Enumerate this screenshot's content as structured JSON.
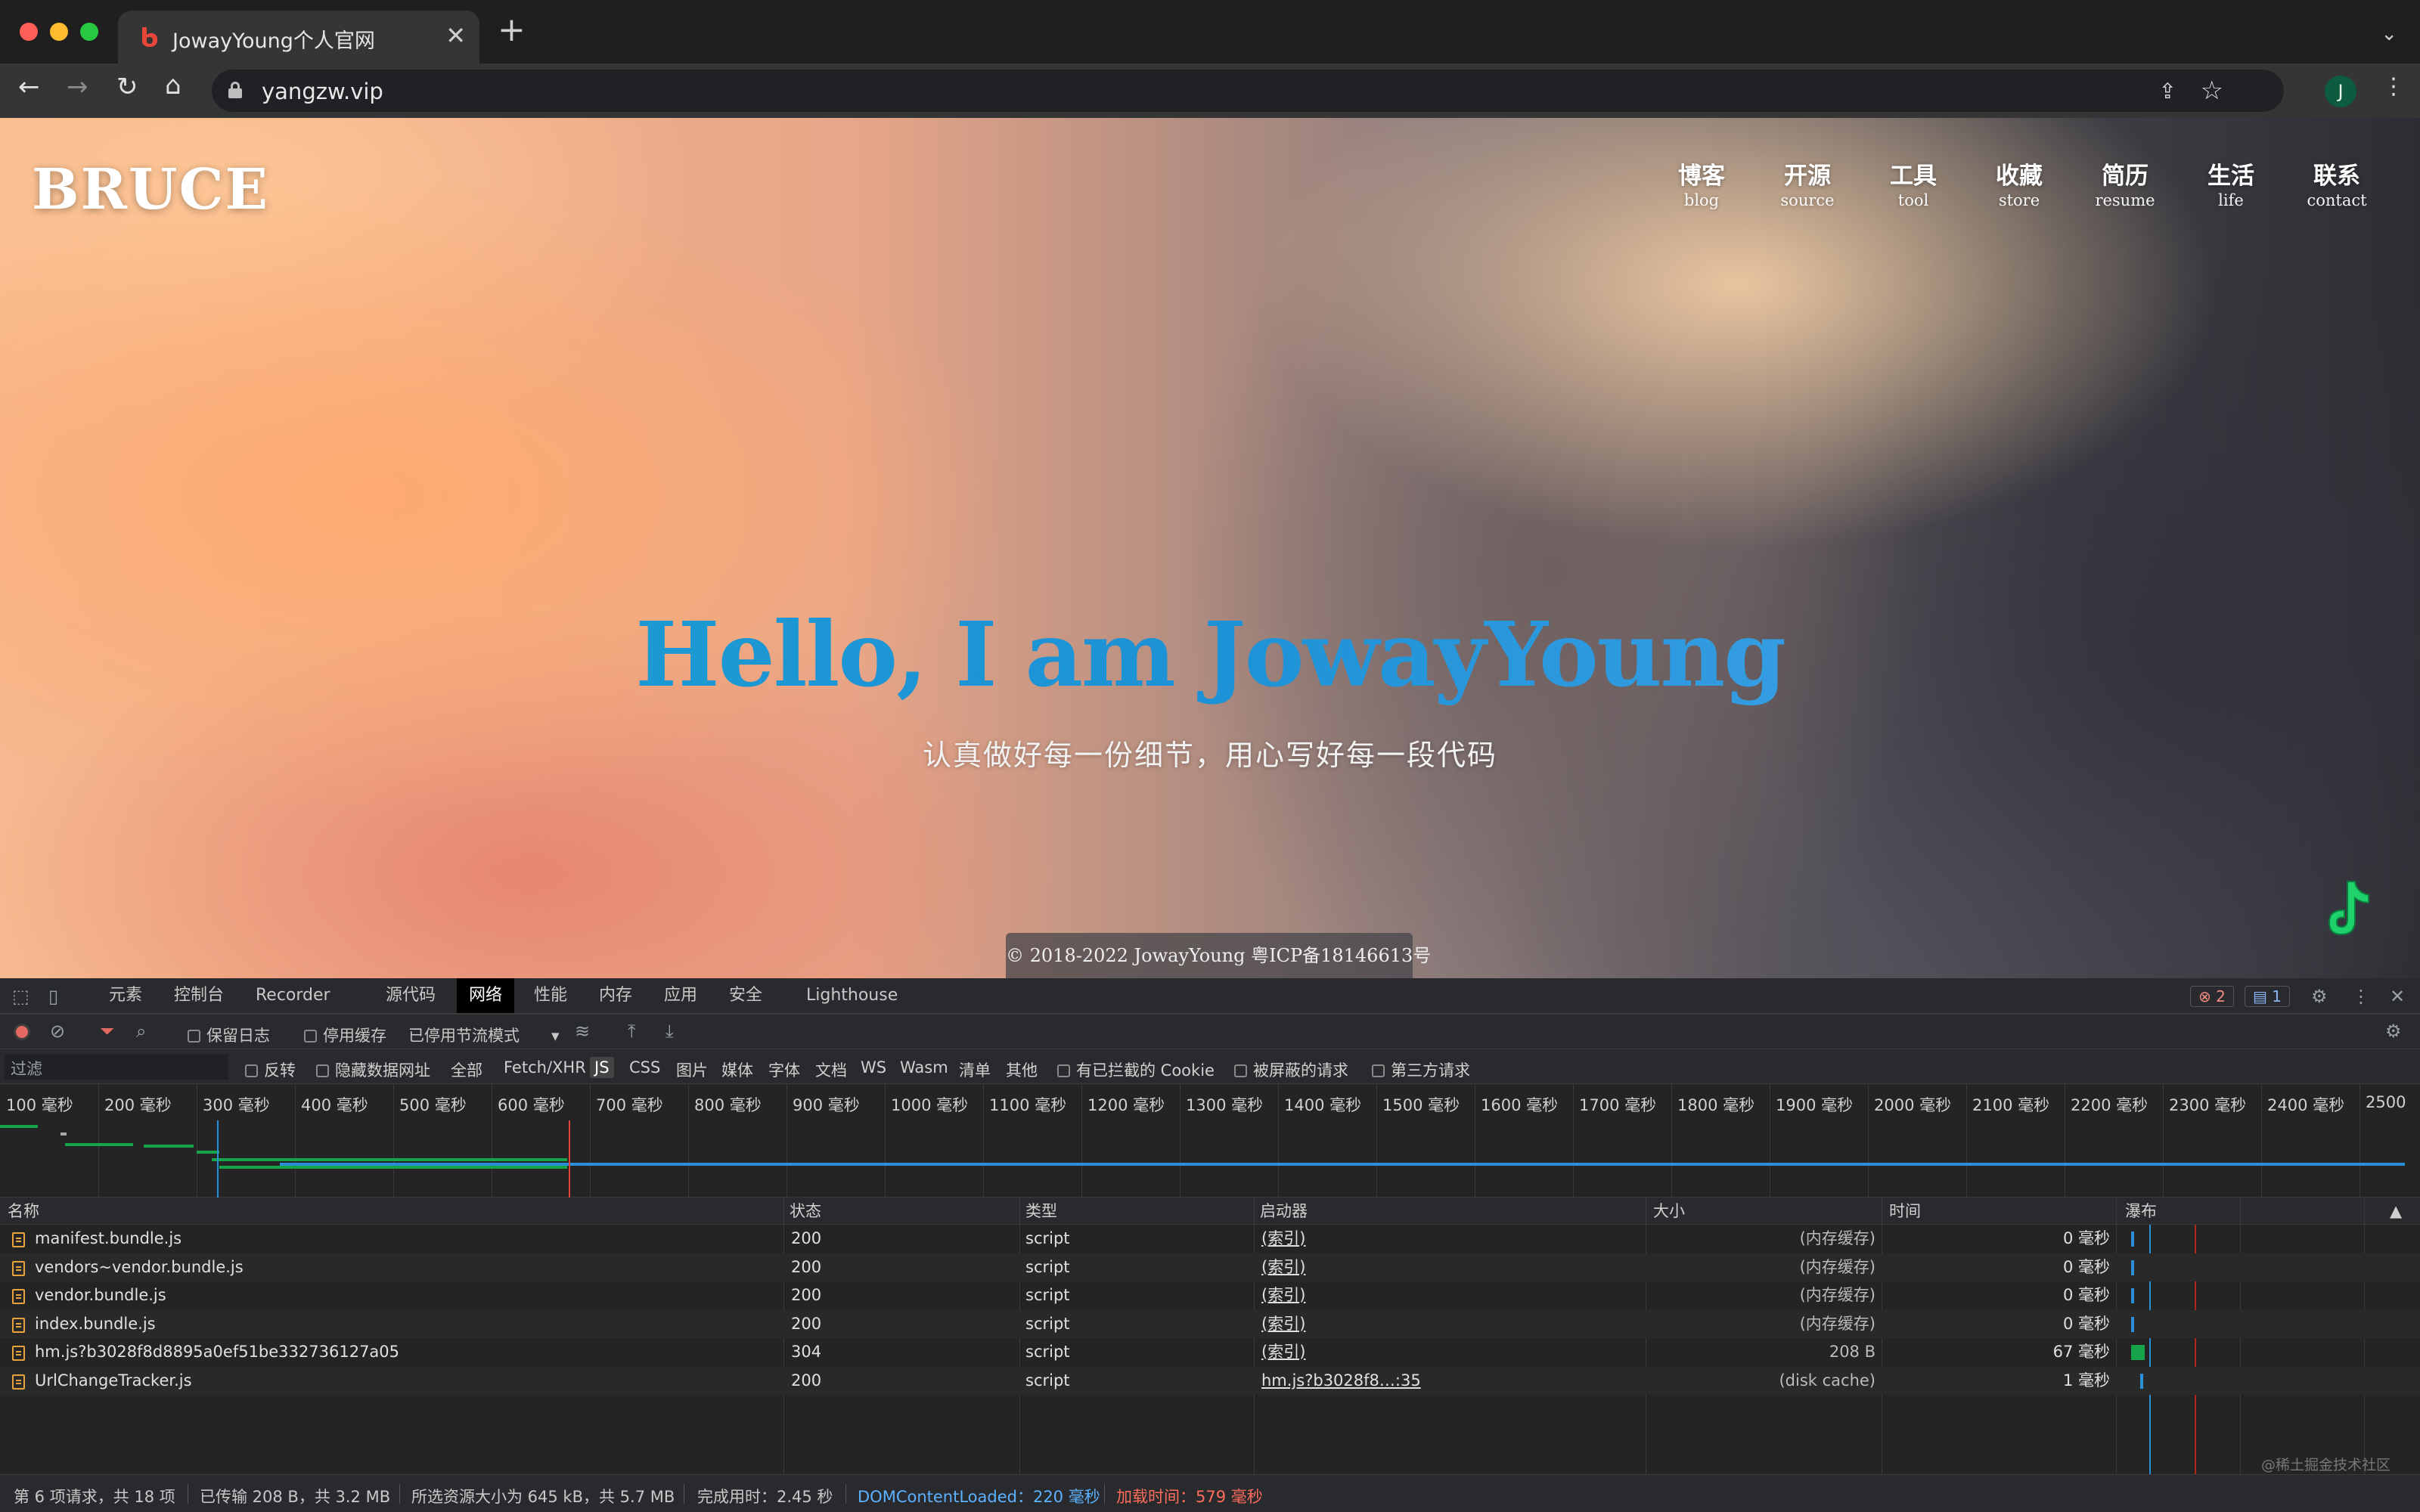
{
  "browser": {
    "tab_title": "JowayYoung个人官网",
    "url": "yangzw.vip",
    "avatar_letter": "J",
    "colors": {
      "accent": "#1d92d6",
      "tab_bg": "#353535",
      "favicon": "#e8463b"
    }
  },
  "site": {
    "logo": "BRUCE",
    "nav": [
      {
        "zh": "博客",
        "en": "blog"
      },
      {
        "zh": "开源",
        "en": "source"
      },
      {
        "zh": "工具",
        "en": "tool"
      },
      {
        "zh": "收藏",
        "en": "store"
      },
      {
        "zh": "简历",
        "en": "resume"
      },
      {
        "zh": "生活",
        "en": "life"
      },
      {
        "zh": "联系",
        "en": "contact"
      }
    ],
    "hero_title": "Hello, I am JowayYoung",
    "hero_subtitle": "认真做好每一份细节，用心写好每一段代码",
    "copyright": "© 2018-2022 JowayYoung  粤ICP备18146613号"
  },
  "devtools": {
    "tabs": [
      "元素",
      "控制台",
      "Recorder",
      "源代码",
      "网络",
      "性能",
      "内存",
      "应用",
      "安全",
      "Lighthouse"
    ],
    "active_tab": "网络",
    "error_count": "2",
    "message_count": "1",
    "toolbar": {
      "preserve_log": "保留日志",
      "disable_cache": "停用缓存",
      "throttling": "已停用节流模式"
    },
    "filter": {
      "placeholder": "过滤",
      "invert": "反转",
      "hide_data_urls": "隐藏数据网址",
      "types": [
        "全部",
        "Fetch/XHR",
        "JS",
        "CSS",
        "图片",
        "媒体",
        "字体",
        "文档",
        "WS",
        "Wasm",
        "清单",
        "其他"
      ],
      "selected_type": "JS",
      "blocked_cookies": "有已拦截的 Cookie",
      "blocked_requests": "被屏蔽的请求",
      "third_party": "第三方请求"
    },
    "timeline_ticks": [
      "100 毫秒",
      "200 毫秒",
      "300 毫秒",
      "400 毫秒",
      "500 毫秒",
      "600 毫秒",
      "700 毫秒",
      "800 毫秒",
      "900 毫秒",
      "1000 毫秒",
      "1100 毫秒",
      "1200 毫秒",
      "1300 毫秒",
      "1400 毫秒",
      "1500 毫秒",
      "1600 毫秒",
      "1700 毫秒",
      "1800 毫秒",
      "1900 毫秒",
      "2000 毫秒",
      "2100 毫秒",
      "2200 毫秒",
      "2300 毫秒",
      "2400 毫秒",
      "2500"
    ],
    "columns": [
      "名称",
      "状态",
      "类型",
      "启动器",
      "大小",
      "时间",
      "瀑布"
    ],
    "rows": [
      {
        "name": "manifest.bundle.js",
        "status": "200",
        "type": "script",
        "initiator": "(索引)",
        "size": "(内存缓存)",
        "time": "0 毫秒"
      },
      {
        "name": "vendors~vendor.bundle.js",
        "status": "200",
        "type": "script",
        "initiator": "(索引)",
        "size": "(内存缓存)",
        "time": "0 毫秒"
      },
      {
        "name": "vendor.bundle.js",
        "status": "200",
        "type": "script",
        "initiator": "(索引)",
        "size": "(内存缓存)",
        "time": "0 毫秒"
      },
      {
        "name": "index.bundle.js",
        "status": "200",
        "type": "script",
        "initiator": "(索引)",
        "size": "(内存缓存)",
        "time": "0 毫秒"
      },
      {
        "name": "hm.js?b3028f8d8895a0ef51be332736127a05",
        "status": "304",
        "type": "script",
        "initiator": "(索引)",
        "size": "208 B",
        "time": "67 毫秒"
      },
      {
        "name": "UrlChangeTracker.js",
        "status": "200",
        "type": "script",
        "initiator": "hm.js?b3028f8…:35",
        "size": "(disk cache)",
        "time": "1 毫秒"
      }
    ],
    "status": {
      "requests": "第 6 项请求，共 18 项",
      "transferred": "已传输 208 B，共 3.2 MB",
      "resources": "所选资源大小为 645 kB，共 5.7 MB",
      "finish": "完成用时：2.45 秒",
      "dom_content_loaded": "DOMContentLoaded：220 毫秒",
      "load": "加载时间：579 毫秒"
    },
    "watermark": "@稀土掘金技术社区"
  }
}
